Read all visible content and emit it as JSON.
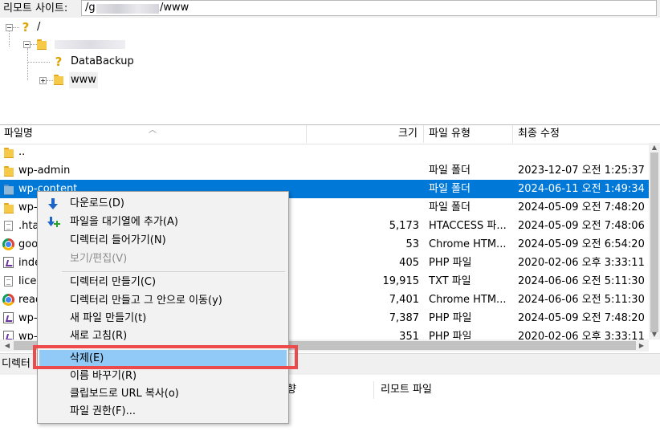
{
  "site_bar": {
    "label": "리모트 사이트:",
    "path_prefix": "/g",
    "path_suffix": "/www"
  },
  "tree": {
    "root_label": "/",
    "child_label": "",
    "items": [
      "DataBackup",
      "www"
    ]
  },
  "list_header": {
    "filename": "파일명",
    "size": "크기",
    "type": "파일 유형",
    "modified": "최종 수정"
  },
  "files": [
    {
      "name": "..",
      "size": "",
      "type": "",
      "modified": "",
      "icon": "folder"
    },
    {
      "name": "wp-admin",
      "size": "",
      "type": "파일 폴더",
      "modified": "2023-12-07 오전 1:25:37",
      "icon": "folder"
    },
    {
      "name": "wp-content",
      "size": "",
      "type": "파일 폴더",
      "modified": "2024-06-11 오전 1:49:34",
      "icon": "folder",
      "selected": true
    },
    {
      "name": "wp-",
      "size": "",
      "type": "파일 폴더",
      "modified": "2024-05-09 오전 7:48:20",
      "icon": "folder"
    },
    {
      "name": ".htac",
      "size": "5,173",
      "type": "HTACCESS 파...",
      "modified": "2024-05-09 오전 7:48:06",
      "icon": "file"
    },
    {
      "name": "goo",
      "size": "53",
      "type": "Chrome HTM...",
      "modified": "2024-05-09 오전 6:54:20",
      "icon": "chrome"
    },
    {
      "name": "inde",
      "size": "405",
      "type": "PHP 파일",
      "modified": "2020-02-06 오후 3:33:11",
      "icon": "php"
    },
    {
      "name": "licer",
      "size": "19,915",
      "type": "TXT 파일",
      "modified": "2024-06-06 오전 5:11:30",
      "icon": "file"
    },
    {
      "name": "read",
      "size": "7,401",
      "type": "Chrome HTM...",
      "modified": "2024-06-06 오전 5:11:30",
      "icon": "chrome"
    },
    {
      "name": "wp-",
      "size": "7,387",
      "type": "PHP 파일",
      "modified": "2024-05-09 오전 7:48:20",
      "icon": "php"
    },
    {
      "name": "wp-",
      "size": "351",
      "type": "PHP 파일",
      "modified": "2020-02-06 오후 3:33:11",
      "icon": "php"
    }
  ],
  "status_text": "디렉터",
  "queue_header": {
    "direction": "향",
    "remote_file": "리모트 파일"
  },
  "context_menu": {
    "items": [
      {
        "label": "다운로드(D)",
        "icon": "download-arrow-icon"
      },
      {
        "label": "파일을 대기열에 추가(A)",
        "icon": "add-to-queue-icon"
      },
      {
        "label": "디렉터리 들어가기(N)"
      },
      {
        "label": "보기/편집(V)",
        "disabled": true
      },
      {
        "label": "디렉터리 만들기(C)"
      },
      {
        "label": "디렉터리 만들고 그 안으로 이동(y)"
      },
      {
        "label": "새 파일 만들기(t)"
      },
      {
        "label": "새로 고침(R)"
      },
      {
        "label": "삭제(E)",
        "highlighted": true
      },
      {
        "label": "이름 바꾸기(R)"
      },
      {
        "label": "클립보드로 URL 복사(o)"
      },
      {
        "label": "파일 권한(F)..."
      }
    ]
  },
  "colors": {
    "selection": "#0078d7",
    "menu_highlight": "#91c9f7",
    "annotation_box": "#ed4b4b"
  }
}
